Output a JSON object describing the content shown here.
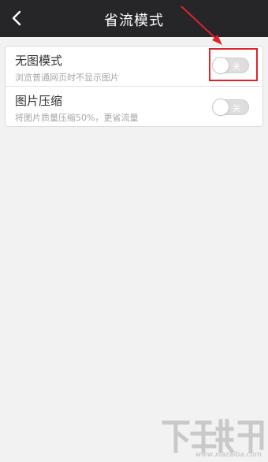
{
  "header": {
    "title": "省流模式",
    "back_icon": "chevron-left-icon"
  },
  "settings": [
    {
      "title": "无图模式",
      "subtitle": "浏览普通网页时不显示图片",
      "toggle_label": "关",
      "enabled": false
    },
    {
      "title": "图片压缩",
      "subtitle": "将图片质量压缩50%，更省流量",
      "toggle_label": "关",
      "enabled": false
    }
  ],
  "watermark": {
    "url": "www.xiazaiba.com"
  },
  "colors": {
    "header_bg": "#262629",
    "annotation_red": "#e0222a",
    "toggle_off": "#dedede",
    "background": "#f2f2f2"
  }
}
